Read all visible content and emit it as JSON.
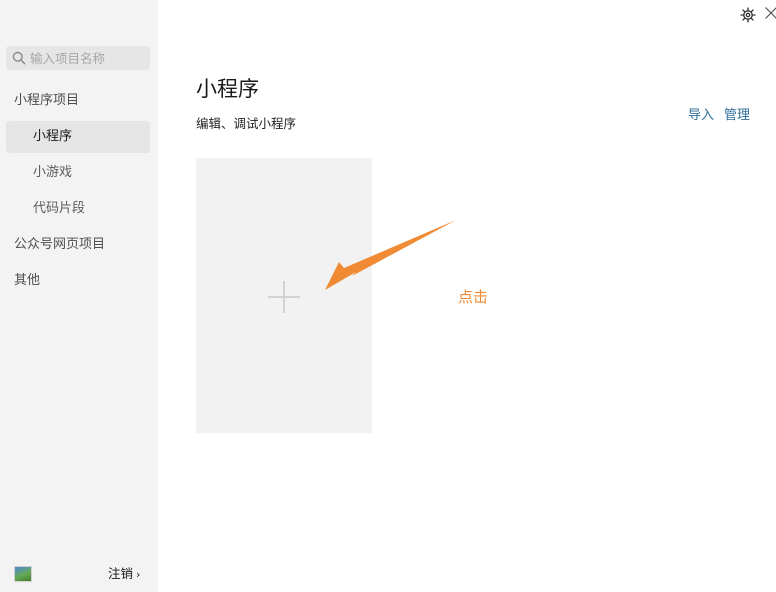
{
  "sidebar": {
    "search": {
      "placeholder": "输入项目名称",
      "value": ""
    },
    "groups": {
      "miniprogram_project": "小程序项目",
      "miniprogram": "小程序",
      "minigame": "小游戏",
      "code_snippet": "代码片段",
      "official_account_web": "公众号网页项目",
      "other": "其他"
    },
    "active_item": "小程序",
    "logout_label": "注销",
    "logout_chevron": "›"
  },
  "main": {
    "title": "小程序",
    "subtitle": "编辑、调试小程序",
    "actions": {
      "import": "导入",
      "manage": "管理"
    },
    "new_project_card": {
      "icon": "plus-icon"
    }
  },
  "annotation": {
    "text": "点击",
    "color": "#f08a34"
  },
  "colors": {
    "sidebar_bg": "#f3f3f3",
    "active_item_bg": "#e5e5e5",
    "link": "#2f6d99",
    "card_bg": "#f2f2f2",
    "annotation": "#f08a34"
  },
  "icons": {
    "search": "search-icon",
    "settings": "gear-icon",
    "close": "close-icon",
    "new_project": "plus-icon",
    "user": "avatar"
  }
}
